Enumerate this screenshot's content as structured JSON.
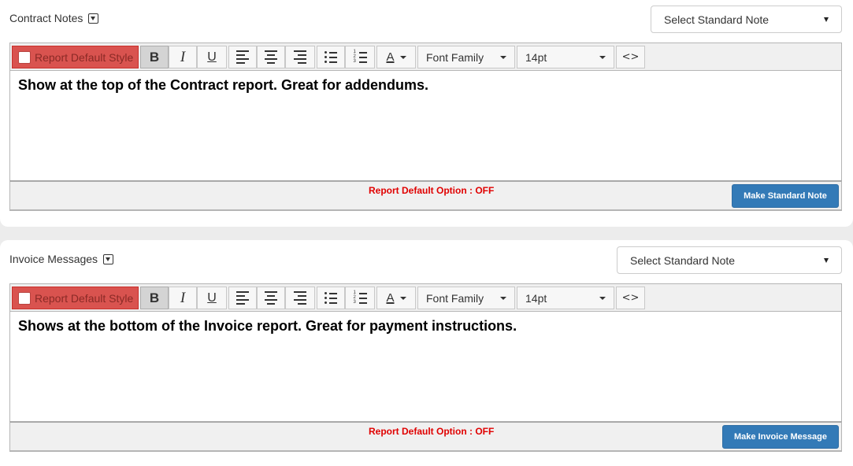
{
  "toolbar": {
    "default_style_label": "Report Default Style",
    "bold": "B",
    "italic": "I",
    "underline": "U",
    "color_letter": "A",
    "font_family": "Font Family",
    "font_size": "14pt",
    "code": "<>",
    "icons": [
      "align-left-icon",
      "align-center-icon",
      "align-right-icon",
      "bullet-list-icon",
      "numbered-list-icon",
      "text-color-icon",
      "code-view-icon"
    ]
  },
  "sections": [
    {
      "title": "Contract Notes",
      "select_value": "Select Standard Note",
      "content": "Show at the top of the Contract report. Great for addendums.",
      "default_option": "Report Default Option : OFF",
      "button": "Make Standard Note"
    },
    {
      "title": "Invoice Messages",
      "select_value": "Select Standard Note",
      "content": "Shows at the bottom of the Invoice report. Great for payment instructions.",
      "default_option": "Report Default Option : OFF",
      "button": "Make Invoice Message"
    }
  ],
  "colors": {
    "default_style_bg": "#d9534f",
    "primary_button": "#337ab7",
    "option_text": "#e00000"
  }
}
